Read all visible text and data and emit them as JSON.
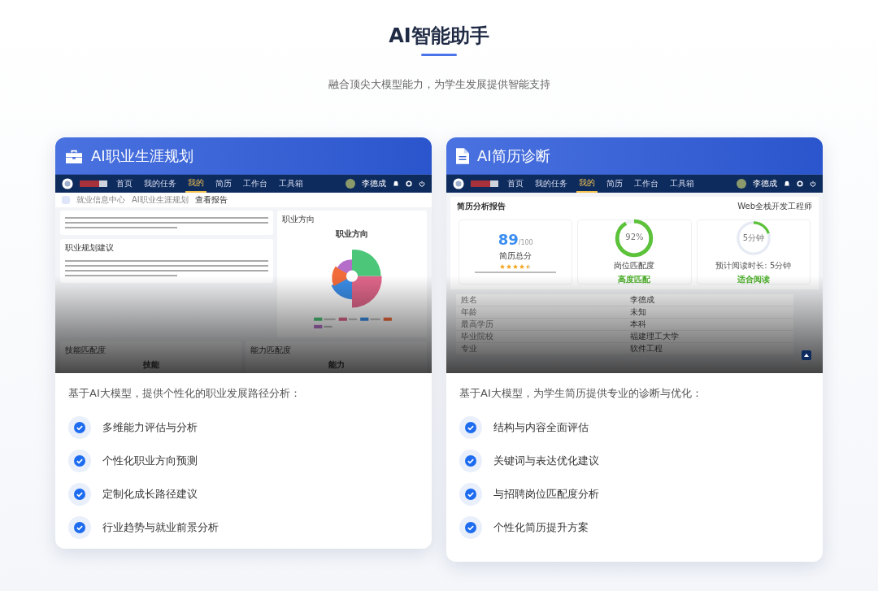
{
  "header": {
    "title": "AI智能助手",
    "subtitle": "融合顶尖大模型能力，为学生发展提供智能支持"
  },
  "cards": [
    {
      "title": "AI职业生涯规划",
      "preview": {
        "kind": "career",
        "nav": [
          {
            "label": "首页",
            "selected": false
          },
          {
            "label": "我的任务",
            "selected": false
          },
          {
            "label": "我的",
            "selected": true
          },
          {
            "label": "简历",
            "selected": false
          },
          {
            "label": "工作台",
            "selected": false
          },
          {
            "label": "工具箱",
            "selected": false
          }
        ],
        "user": "李德成",
        "breadcrumb": [
          "就业信息中心",
          "AI职业生涯规划",
          "查看报告"
        ],
        "panels": [
          "职业规划建议"
        ],
        "chart_panel": "职业方向",
        "chart_title": "职业方向",
        "bottom_panels": [
          {
            "title": "技能匹配度",
            "label": "技能"
          },
          {
            "title": "能力匹配度",
            "label": "能力"
          }
        ]
      },
      "intro": "基于AI大模型，提供个性化的职业发展路径分析：",
      "features": [
        "多维能力评估与分析",
        "个性化职业方向预测",
        "定制化成长路径建议",
        "行业趋势与就业前景分析"
      ]
    },
    {
      "title": "AI简历诊断",
      "preview": {
        "kind": "resume",
        "nav": [
          {
            "label": "首页",
            "selected": false
          },
          {
            "label": "我的任务",
            "selected": false
          },
          {
            "label": "我的",
            "selected": true
          },
          {
            "label": "简历",
            "selected": false
          },
          {
            "label": "工作台",
            "selected": false
          },
          {
            "label": "工具箱",
            "selected": false
          }
        ],
        "user": "李德成",
        "report_title": "简历分析报告",
        "position": "Web全栈开发工程师",
        "score": "89",
        "score_max": "/100",
        "score_label": "简历总分",
        "stars": 4.5,
        "match": {
          "level": 0.92,
          "reading": "92%",
          "label": "岗位匹配度",
          "verdict": "高度匹配"
        },
        "reading_time": {
          "level": 0.2,
          "reading": "5分钟",
          "caption": "预计阅读时长: 5分钟",
          "verdict": "适合阅读"
        },
        "rows": [
          {
            "field": "姓名",
            "value": "李德成"
          },
          {
            "field": "年龄",
            "value": "未知"
          },
          {
            "field": "最高学历",
            "value": "本科"
          },
          {
            "field": "毕业院校",
            "value": "福建理工大学"
          },
          {
            "field": "专业",
            "value": "软件工程"
          }
        ]
      },
      "intro": "基于AI大模型，为学生简历提供专业的诊断与优化：",
      "features": [
        "结构与内容全面评估",
        "关键词与表达优化建议",
        "与招聘岗位匹配度分析",
        "个性化简历提升方案"
      ]
    }
  ]
}
